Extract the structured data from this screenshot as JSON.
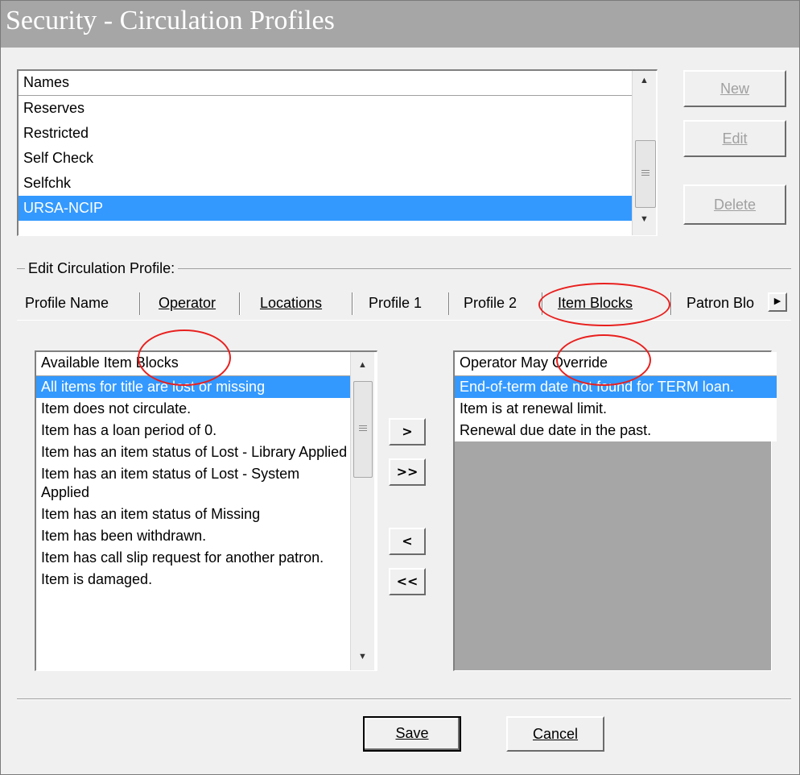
{
  "window": {
    "title": "Security - Circulation Profiles"
  },
  "names_list": {
    "header": "Names",
    "items": [
      "Reserves",
      "Restricted",
      "Self Check",
      "Selfchk",
      "URSA-NCIP"
    ],
    "selected": "URSA-NCIP"
  },
  "side_buttons": {
    "new_label": "New",
    "edit_label": "Edit",
    "delete_label": "Delete"
  },
  "edit_group": {
    "label": "Edit Circulation Profile:"
  },
  "tabs": [
    "Profile Name",
    "Operator",
    "Locations",
    "Profile 1",
    "Profile 2",
    "Item Blocks",
    "Patron Blo"
  ],
  "active_tab": "Item Blocks",
  "available_list": {
    "header": "Available Item Blocks",
    "items": [
      "All items for title are lost or missing",
      "Item does not circulate.",
      "Item has a loan period of 0.",
      "Item has an item status of Lost - Library Applied",
      "Item has an item status of Lost - System Applied",
      "Item has an item status of Missing",
      "Item has been withdrawn.",
      "Item has call slip request for another patron.",
      "Item is damaged."
    ]
  },
  "move_buttons": {
    "add_one": ">",
    "add_all": ">>",
    "remove_one": "<",
    "remove_all": "<<"
  },
  "override_list": {
    "header": "Operator May Override",
    "items": [
      "End-of-term date not found for TERM loan.",
      "Item is at renewal limit.",
      "Renewal due date in the past."
    ]
  },
  "footer": {
    "save_label": "Save",
    "cancel_label": "Cancel"
  },
  "colors": {
    "selection": "#3399ff",
    "title_bar": "#a6a6a6",
    "annotation": "#e8201e"
  },
  "icons": {
    "scroll_up": "triangle-up-icon",
    "scroll_down": "triangle-down-icon",
    "tab_scroll": "triangle-right-icon"
  }
}
